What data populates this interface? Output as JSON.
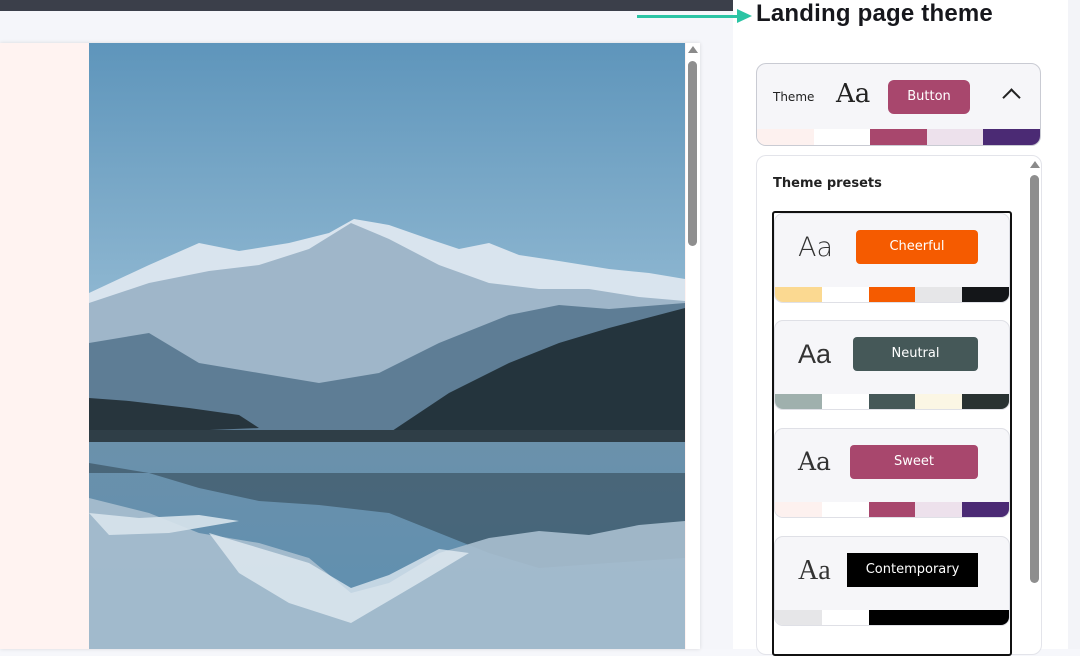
{
  "callout": {
    "title": "Landing page theme"
  },
  "theme": {
    "label": "Theme",
    "font_sample": "Aa",
    "button_label": "Button",
    "button_color": "#a8476d",
    "swatches": [
      "#fdf1ef",
      "#ffffff",
      "#a8476d",
      "#ede1ec",
      "#4b2a74"
    ]
  },
  "presets": {
    "title": "Theme presets",
    "items": [
      {
        "name": "Cheerful",
        "font_sample": "Aa",
        "button_color": "#f55b00",
        "swatches": [
          "#fbd991",
          "#ffffff",
          "#f55b00",
          "#e6e6e8",
          "#141619"
        ]
      },
      {
        "name": "Neutral",
        "font_sample": "Aa",
        "button_color": "#455858",
        "swatches": [
          "#9fb0ad",
          "#ffffff",
          "#455858",
          "#fbf6e4",
          "#293232"
        ]
      },
      {
        "name": "Sweet",
        "font_sample": "Aa",
        "button_color": "#a8476d",
        "swatches": [
          "#fdf1ef",
          "#ffffff",
          "#a8476d",
          "#ede1ec",
          "#4b2a74"
        ]
      },
      {
        "name": "Contemporary",
        "font_sample": "Aa",
        "button_color": "#000000",
        "swatches": [
          "#e6e6e8",
          "#ffffff",
          "#000000",
          "#000000",
          "#000000"
        ]
      }
    ]
  }
}
